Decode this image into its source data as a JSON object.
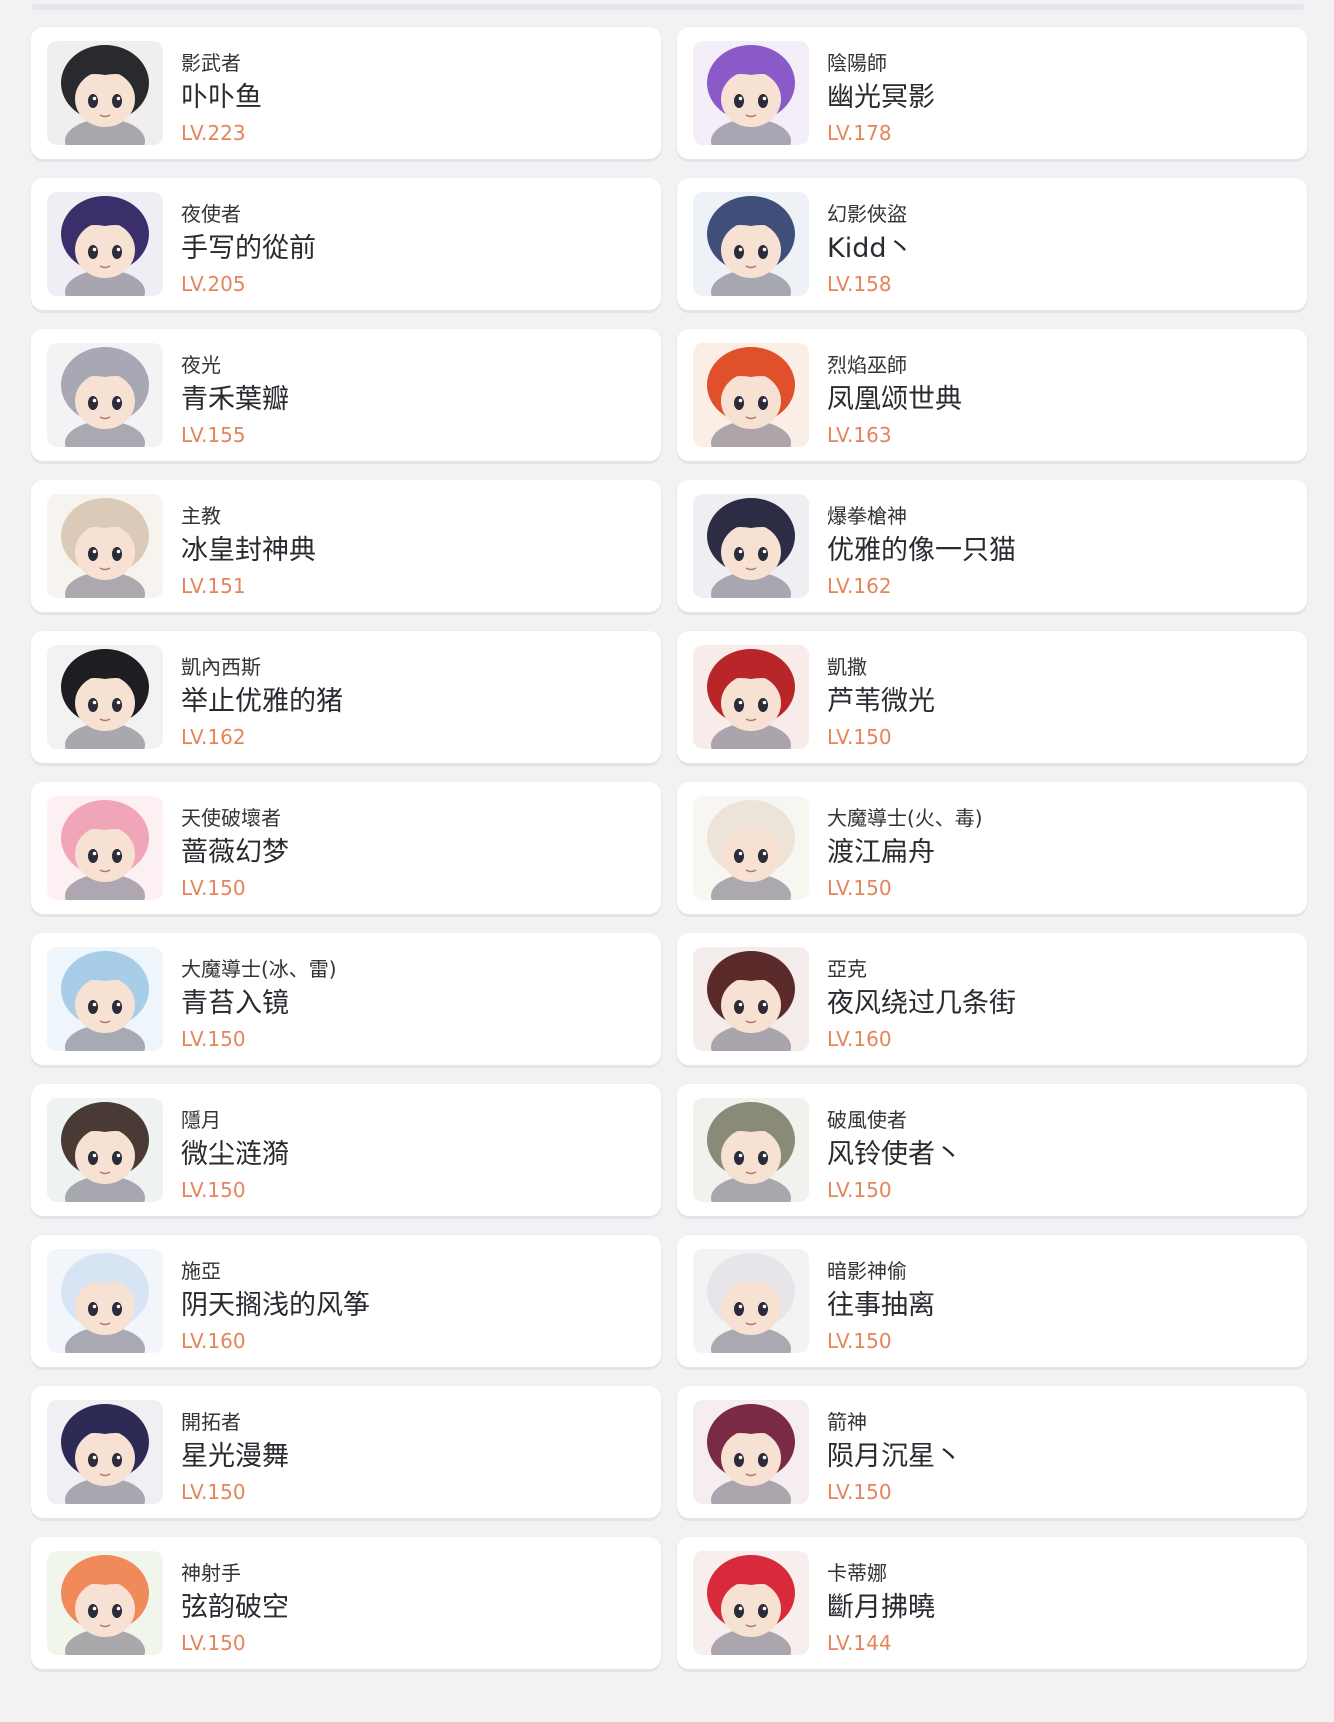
{
  "colors": {
    "background": "#f2f2f4",
    "card": "#ffffff",
    "level_text": "#e4855c",
    "job_text": "#333338",
    "name_text": "#2a2a30"
  },
  "characters": [
    {
      "job": "影武者",
      "name": "卟卟鱼",
      "level": "LV.223",
      "hair": "#2a2a2e",
      "bg": "#f1efee"
    },
    {
      "job": "陰陽師",
      "name": "幽光冥影",
      "level": "LV.178",
      "hair": "#8a5ac8",
      "bg": "#f3eef8"
    },
    {
      "job": "夜使者",
      "name": "手写的從前",
      "level": "LV.205",
      "hair": "#3b2f6b",
      "bg": "#f0eef4"
    },
    {
      "job": "幻影俠盜",
      "name": "Kidd丶",
      "level": "LV.158",
      "hair": "#3f4f7a",
      "bg": "#eef2f6"
    },
    {
      "job": "夜光",
      "name": "青禾葉瓣",
      "level": "LV.155",
      "hair": "#a8a8b4",
      "bg": "#f3f3f5"
    },
    {
      "job": "烈焰巫師",
      "name": "凤凰颂世典",
      "level": "LV.163",
      "hair": "#e0502a",
      "bg": "#fbeee6"
    },
    {
      "job": "主教",
      "name": "冰皇封神典",
      "level": "LV.151",
      "hair": "#dccab8",
      "bg": "#f7f3ef"
    },
    {
      "job": "爆拳槍神",
      "name": "优雅的像一只猫",
      "level": "LV.162",
      "hair": "#2c2c44",
      "bg": "#efeff3"
    },
    {
      "job": "凱內西斯",
      "name": "举止优雅的猪",
      "level": "LV.162",
      "hair": "#1e1e22",
      "bg": "#f2f2f2"
    },
    {
      "job": "凱撒",
      "name": "芦苇微光",
      "level": "LV.150",
      "hair": "#b8262a",
      "bg": "#f8ecea"
    },
    {
      "job": "天使破壞者",
      "name": "蔷薇幻梦",
      "level": "LV.150",
      "hair": "#f0a6b8",
      "bg": "#fdf0f3"
    },
    {
      "job": "大魔導士(火、毒)",
      "name": "渡江扁舟",
      "level": "LV.150",
      "hair": "#ece4d8",
      "bg": "#f8f6f0"
    },
    {
      "job": "大魔導士(冰、雷)",
      "name": "青苔入镜",
      "level": "LV.150",
      "hair": "#a8cde8",
      "bg": "#eef5fb"
    },
    {
      "job": "亞克",
      "name": "夜风绕过几条街",
      "level": "LV.160",
      "hair": "#5a2a2a",
      "bg": "#f3ecea"
    },
    {
      "job": "隱月",
      "name": "微尘涟漪",
      "level": "LV.150",
      "hair": "#4a3a36",
      "bg": "#eef3f1"
    },
    {
      "job": "破風使者",
      "name": "风铃使者丶",
      "level": "LV.150",
      "hair": "#8a8a78",
      "bg": "#f1f2ee"
    },
    {
      "job": "施亞",
      "name": "阴天搁浅的风筝",
      "level": "LV.160",
      "hair": "#d6e4f4",
      "bg": "#f2f6fb"
    },
    {
      "job": "暗影神偷",
      "name": "往事抽离",
      "level": "LV.150",
      "hair": "#e6e6ea",
      "bg": "#f3f3f3"
    },
    {
      "job": "開拓者",
      "name": "星光漫舞",
      "level": "LV.150",
      "hair": "#2e2a56",
      "bg": "#efeff4"
    },
    {
      "job": "箭神",
      "name": "陨月沉星丶",
      "level": "LV.150",
      "hair": "#7a2a44",
      "bg": "#f5edf0"
    },
    {
      "job": "神射手",
      "name": "弦韵破空",
      "level": "LV.150",
      "hair": "#f08a5a",
      "bg": "#f1f6ec"
    },
    {
      "job": "卡蒂娜",
      "name": "斷月拂曉",
      "level": "LV.144",
      "hair": "#d82a3a",
      "bg": "#f7eeee"
    }
  ]
}
